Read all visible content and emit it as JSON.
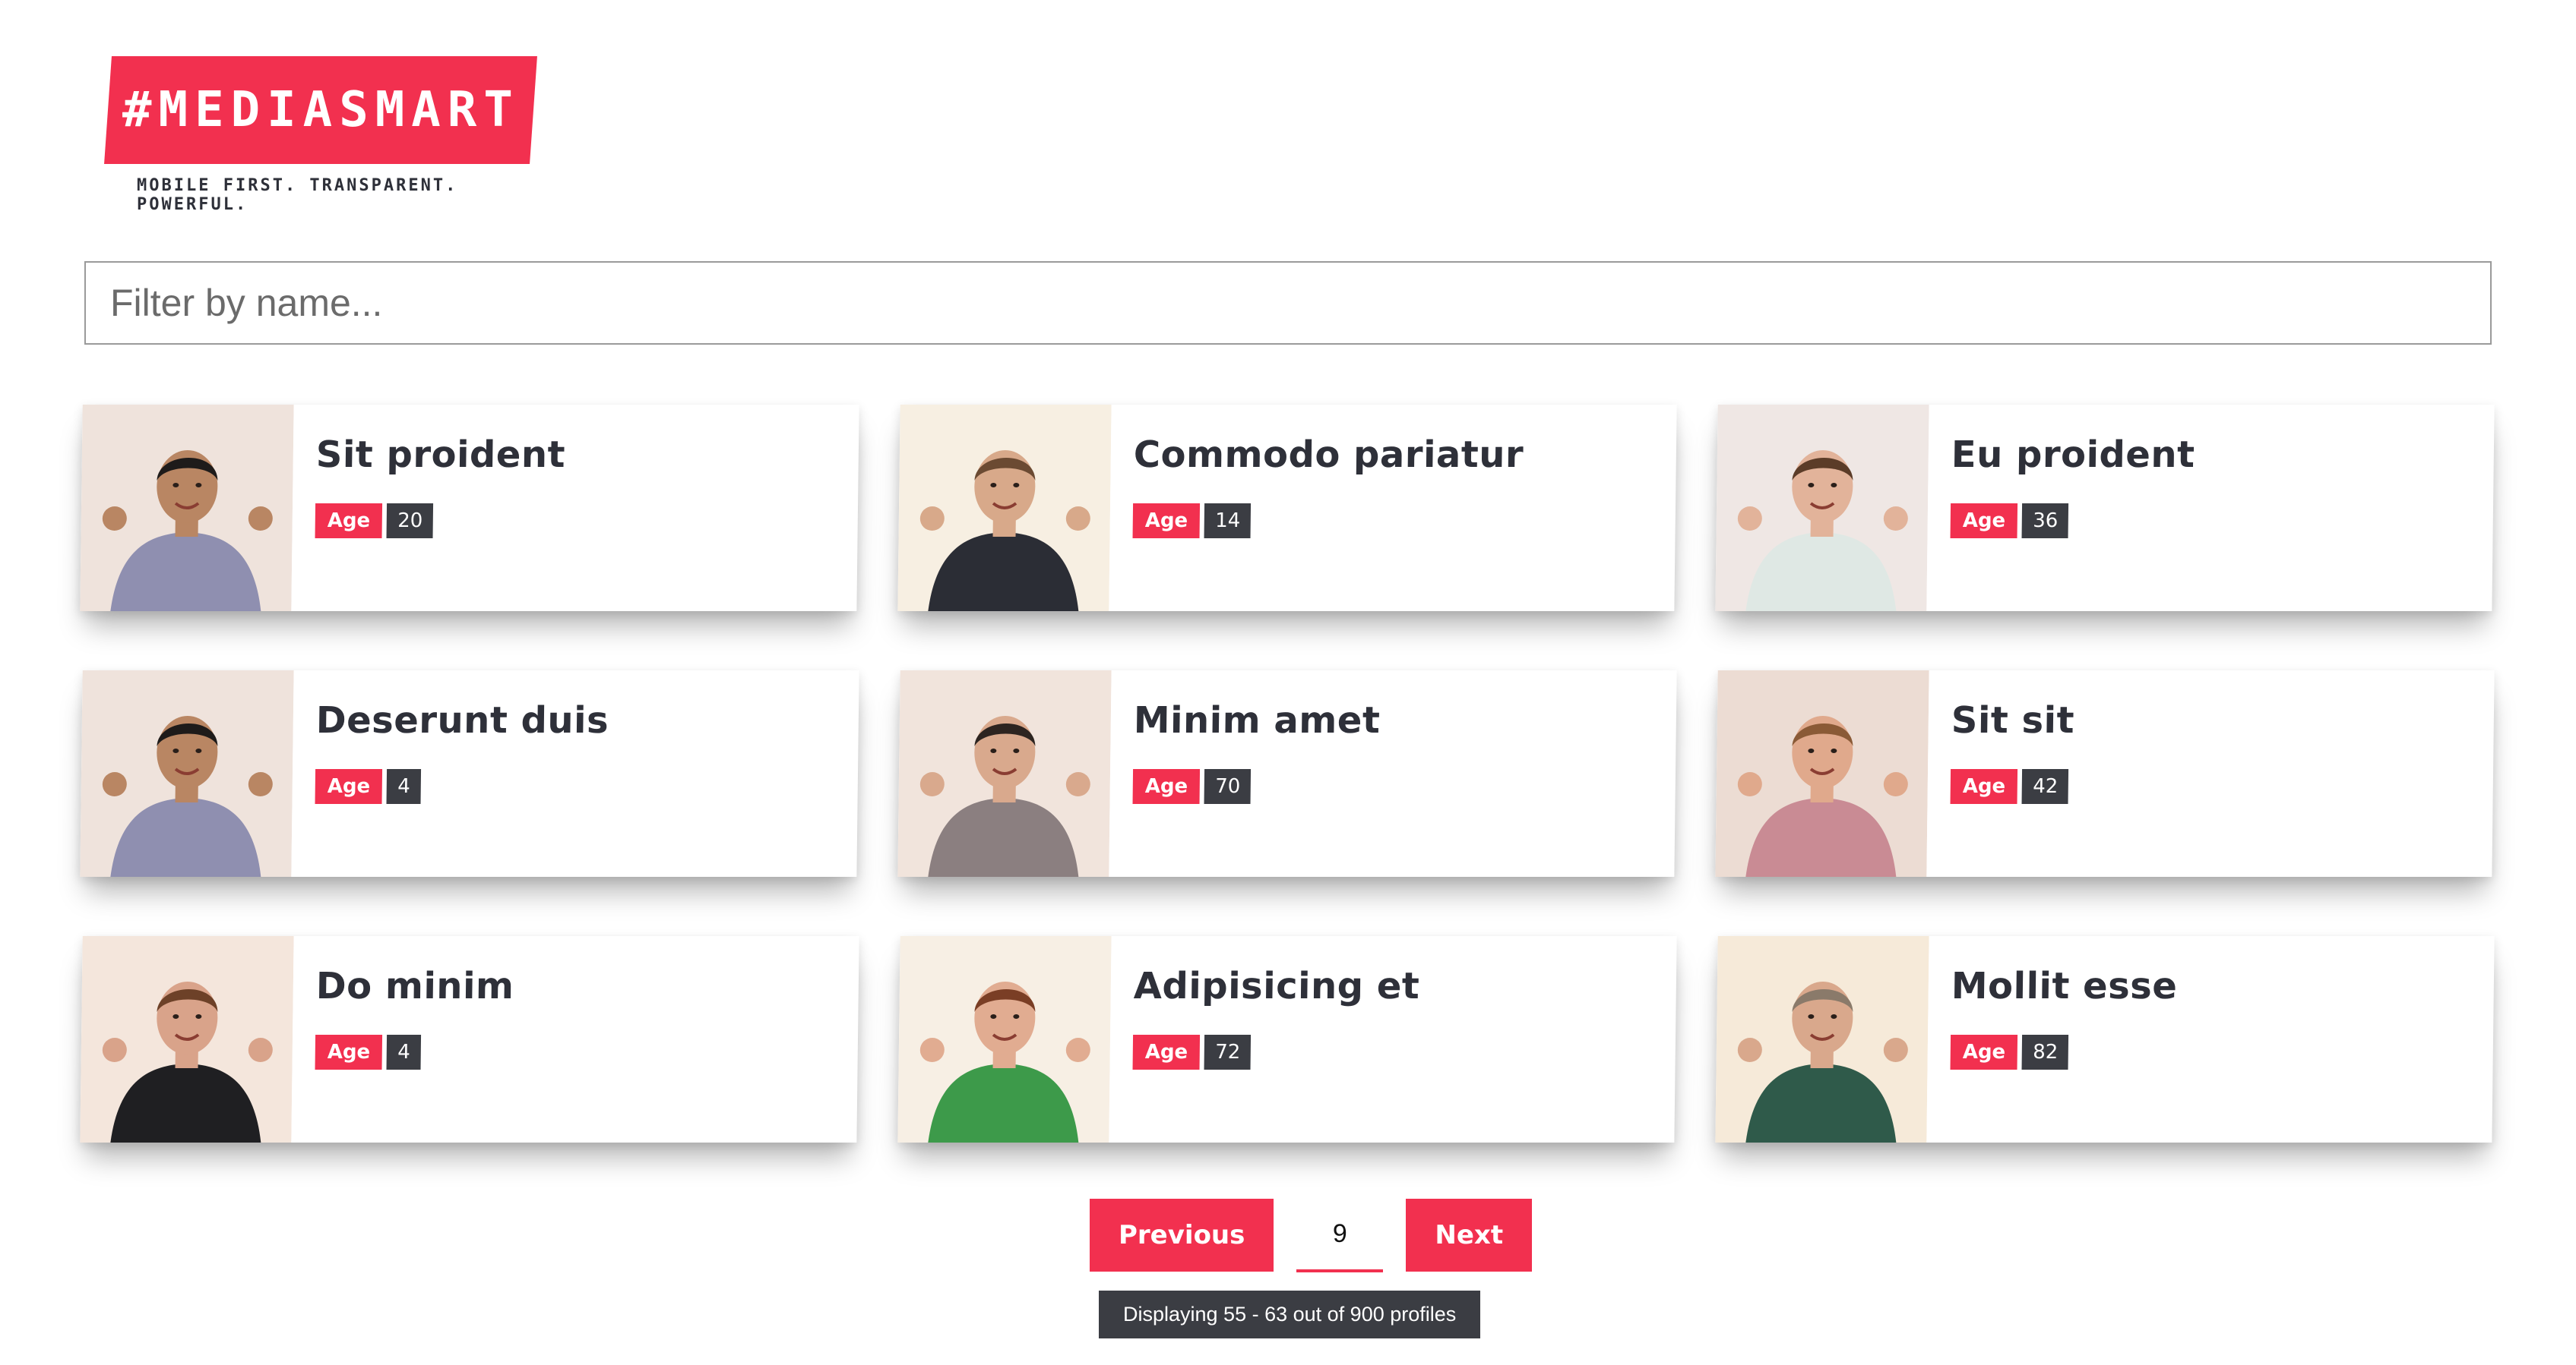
{
  "brand": {
    "logo_text": "#MEDIASMART",
    "tagline": "MOBILE FIRST. TRANSPARENT. POWERFUL.",
    "accent_color": "#f2304f",
    "dark_color": "#3b3d43"
  },
  "filter": {
    "placeholder": "Filter by name...",
    "value": ""
  },
  "profiles": [
    {
      "name": "Sit proident",
      "age_label": "Age",
      "age": "20",
      "photo": "man-thumbs-up"
    },
    {
      "name": "Commodo pariatur",
      "age_label": "Age",
      "age": "14",
      "photo": "man-silly-face"
    },
    {
      "name": "Eu proident",
      "age_label": "Age",
      "age": "36",
      "photo": "man-pointing"
    },
    {
      "name": "Deserunt duis",
      "age_label": "Age",
      "age": "4",
      "photo": "man-thumbs-up"
    },
    {
      "name": "Minim amet",
      "age_label": "Age",
      "age": "70",
      "photo": "man-thinking"
    },
    {
      "name": "Sit sit",
      "age_label": "Age",
      "age": "42",
      "photo": "man-pointing-plaid"
    },
    {
      "name": "Do minim",
      "age_label": "Age",
      "age": "4",
      "photo": "woman-peace-sign"
    },
    {
      "name": "Adipisicing et",
      "age_label": "Age",
      "age": "72",
      "photo": "woman-green-dress"
    },
    {
      "name": "Mollit esse",
      "age_label": "Age",
      "age": "82",
      "photo": "man-arms-crossed"
    }
  ],
  "pagination": {
    "previous_label": "Previous",
    "next_label": "Next",
    "current_page": "9",
    "status": "Displaying 55 - 63 out of 900 profiles"
  }
}
